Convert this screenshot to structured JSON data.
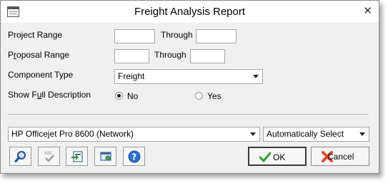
{
  "window": {
    "title": "Freight Analysis Report"
  },
  "form": {
    "project_range_label": "Project Range",
    "through_label_1": "Through",
    "proposal_range_label": [
      "P",
      "r",
      "oposal Range"
    ],
    "through_label_2": "Through",
    "component_type_label": "Component Type",
    "component_type_value": "Freight",
    "show_full_description_label": [
      "Show F",
      "u",
      "ll Description"
    ],
    "option_no": "No",
    "option_yes": "Yes",
    "selected_option": "No"
  },
  "footer": {
    "printer_value": "HP Officejet Pro 8600 (Network)",
    "tray_value": "Automatically Select",
    "ok_label": "OK",
    "cancel_label": "Cancel"
  },
  "icons": {
    "system": "window-menu-icon",
    "close": "close-icon",
    "preview": "magnifier-icon",
    "spellcheck": "spellcheck-icon",
    "export": "export-icon",
    "print_setup": "printer-settings-icon",
    "help": "help-icon",
    "ok": "checkmark-icon",
    "cancel": "cancel-x-icon"
  },
  "colors": {
    "ok_check": "#2ca02c",
    "cancel_x": "#e04a2a",
    "help_blue": "#2a6fd0"
  }
}
